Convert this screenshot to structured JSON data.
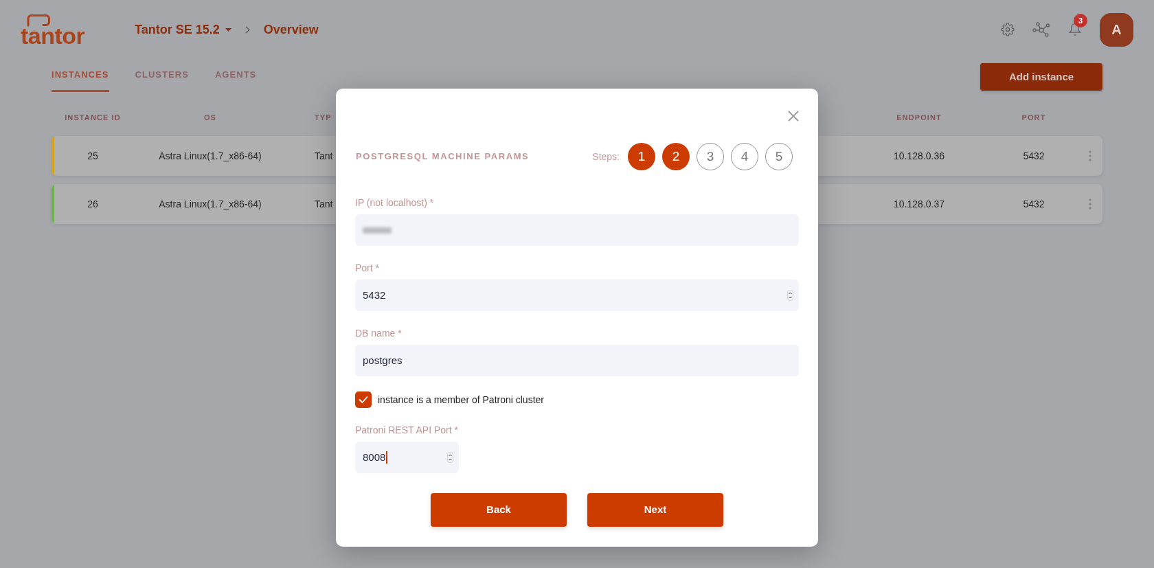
{
  "header": {
    "logo": "tantor",
    "breadcrumb": [
      {
        "label": "Tantor SE 15.2",
        "kind": "dropdown"
      },
      {
        "label": "Overview",
        "kind": "current"
      }
    ],
    "notifications": "3",
    "avatar": "A"
  },
  "tabs": [
    {
      "label": "INSTANCES",
      "selected": true
    },
    {
      "label": "CLUSTERS",
      "selected": false
    },
    {
      "label": "AGENTS",
      "selected": false
    }
  ],
  "add_button": "Add instance",
  "table": {
    "columns": [
      "INSTANCE ID",
      "OS",
      "TYP",
      "ENDPOINT",
      "PORT"
    ],
    "rows": [
      {
        "color": "#d9a30f",
        "cells": [
          "25",
          "Astra Linux(1.7_x86-64)",
          "Tant",
          "10.128.0.36",
          "5432"
        ]
      },
      {
        "color": "#6cb44a",
        "cells": [
          "26",
          "Astra Linux(1.7_x86-64)",
          "Tant",
          "10.128.0.37",
          "5432"
        ]
      }
    ]
  },
  "dialog": {
    "title": "POSTGRESQL MACHINE PARAMS",
    "steps_label": "Steps:",
    "steps": [
      {
        "label": "1",
        "done": true
      },
      {
        "label": "2",
        "done": true
      },
      {
        "label": "3",
        "done": false
      },
      {
        "label": "4",
        "done": false
      },
      {
        "label": "5",
        "done": false
      }
    ],
    "fields": [
      {
        "kind": "text",
        "label": "IP (not localhost) *",
        "redacted": true
      },
      {
        "kind": "number",
        "label": "Port *",
        "value": "5432"
      },
      {
        "kind": "text",
        "label": "DB name *",
        "value": "postgres"
      },
      {
        "kind": "checkbox",
        "label": "instance is a member of Patroni cluster",
        "checked": true
      },
      {
        "kind": "small_number",
        "label": "Patroni REST API Port *",
        "value": "8008",
        "focused": true
      }
    ],
    "buttons": [
      "Back",
      "Next"
    ]
  }
}
